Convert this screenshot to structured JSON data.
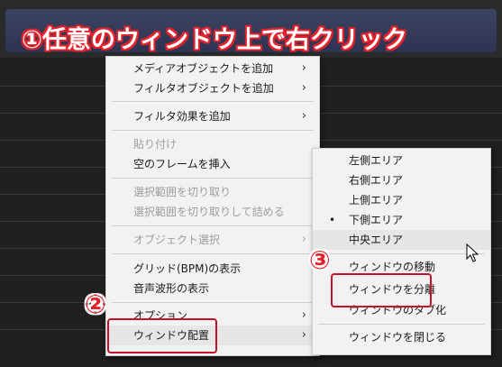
{
  "banner": {
    "text": "①任意のウィンドウ上で右クリック"
  },
  "main_menu": {
    "items": [
      {
        "label": "メディアオブジェクトを追加",
        "has_submenu": true,
        "disabled": false
      },
      {
        "label": "フィルタオブジェクトを追加",
        "has_submenu": true,
        "disabled": false
      },
      {
        "label": "フィルタ効果を追加",
        "has_submenu": true,
        "disabled": false
      },
      {
        "label": "貼り付け",
        "has_submenu": false,
        "disabled": true
      },
      {
        "label": "空のフレームを挿入",
        "has_submenu": false,
        "disabled": false
      },
      {
        "label": "選択範囲を切り取り",
        "has_submenu": false,
        "disabled": true
      },
      {
        "label": "選択範囲を切り取りして詰める",
        "has_submenu": false,
        "disabled": true
      },
      {
        "label": "オブジェクト選択",
        "has_submenu": true,
        "disabled": true
      },
      {
        "label": "グリッド(BPM)の表示",
        "has_submenu": false,
        "disabled": false
      },
      {
        "label": "音声波形の表示",
        "has_submenu": false,
        "disabled": false
      },
      {
        "label": "オプション",
        "has_submenu": true,
        "disabled": false
      },
      {
        "label": "ウィンドウ配置",
        "has_submenu": true,
        "disabled": false,
        "highlighted": true
      }
    ]
  },
  "sub_menu": {
    "items": [
      {
        "label": "左側エリア",
        "checked": false
      },
      {
        "label": "右側エリア",
        "checked": false
      },
      {
        "label": "上側エリア",
        "checked": false
      },
      {
        "label": "下側エリア",
        "checked": true
      },
      {
        "label": "中央エリア",
        "checked": false,
        "highlighted": true
      },
      {
        "label": "ウィンドウの移動",
        "checked": false
      },
      {
        "label": "ウィンドウを分離",
        "checked": false
      },
      {
        "label": "ウィンドウのタブ化",
        "checked": false
      },
      {
        "label": "ウィンドウを閉じる",
        "checked": false
      }
    ]
  },
  "annotations": {
    "step2": "②",
    "step3": "③"
  },
  "icons": {
    "submenu_arrow": "chevron-right-icon",
    "radio_bullet": "bullet-icon",
    "cursor": "mouse-cursor-icon"
  },
  "colors": {
    "annotation_red": "#c8102e",
    "banner_bg": "#343a58",
    "menu_bg": "#f2f2f2"
  }
}
